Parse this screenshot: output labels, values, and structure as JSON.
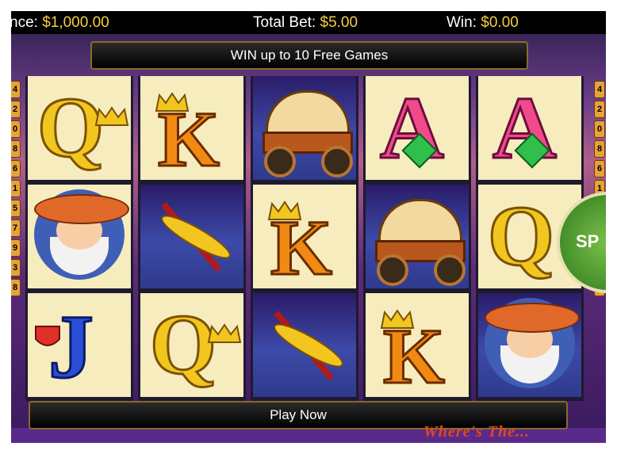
{
  "topbar": {
    "balance_label": "nce:",
    "balance_value": "$1,000.00",
    "total_bet_label": "Total Bet:",
    "total_bet_value": "$5.00",
    "win_label": "Win:",
    "win_value": "$0.00"
  },
  "banner": {
    "text": "WIN up to 10 Free Games"
  },
  "paylines_left": [
    "4",
    "2",
    "0",
    "8",
    "6",
    "1",
    "5",
    "7",
    "9",
    "3",
    "8"
  ],
  "paylines_right": [
    "4",
    "2",
    "0",
    "8",
    "6",
    "1",
    "5",
    "7",
    "9",
    "3",
    "8"
  ],
  "reels": [
    [
      {
        "symbol": "Q",
        "name": "queen-symbol"
      },
      {
        "symbol": "",
        "name": "prospector-symbol"
      },
      {
        "symbol": "J",
        "name": "jack-symbol"
      }
    ],
    [
      {
        "symbol": "K",
        "name": "king-symbol"
      },
      {
        "symbol": "",
        "name": "pickaxe-symbol"
      },
      {
        "symbol": "Q",
        "name": "queen-symbol"
      }
    ],
    [
      {
        "symbol": "",
        "name": "wagon-symbol"
      },
      {
        "symbol": "K",
        "name": "king-symbol"
      },
      {
        "symbol": "",
        "name": "pickaxe-symbol"
      }
    ],
    [
      {
        "symbol": "A",
        "name": "ace-symbol"
      },
      {
        "symbol": "",
        "name": "wagon-symbol"
      },
      {
        "symbol": "K",
        "name": "king-symbol"
      }
    ],
    [
      {
        "symbol": "A",
        "name": "ace-symbol"
      },
      {
        "symbol": "Q",
        "name": "queen-symbol"
      },
      {
        "symbol": "",
        "name": "prospector-symbol"
      }
    ]
  ],
  "spin_button": {
    "label": "SP"
  },
  "play_button": {
    "label": "Play Now"
  },
  "logo": {
    "text": "Where's The..."
  },
  "colors": {
    "accent_gold": "#f4d03f",
    "bar_black": "#000000",
    "spin_green": "#2d7a1c"
  }
}
